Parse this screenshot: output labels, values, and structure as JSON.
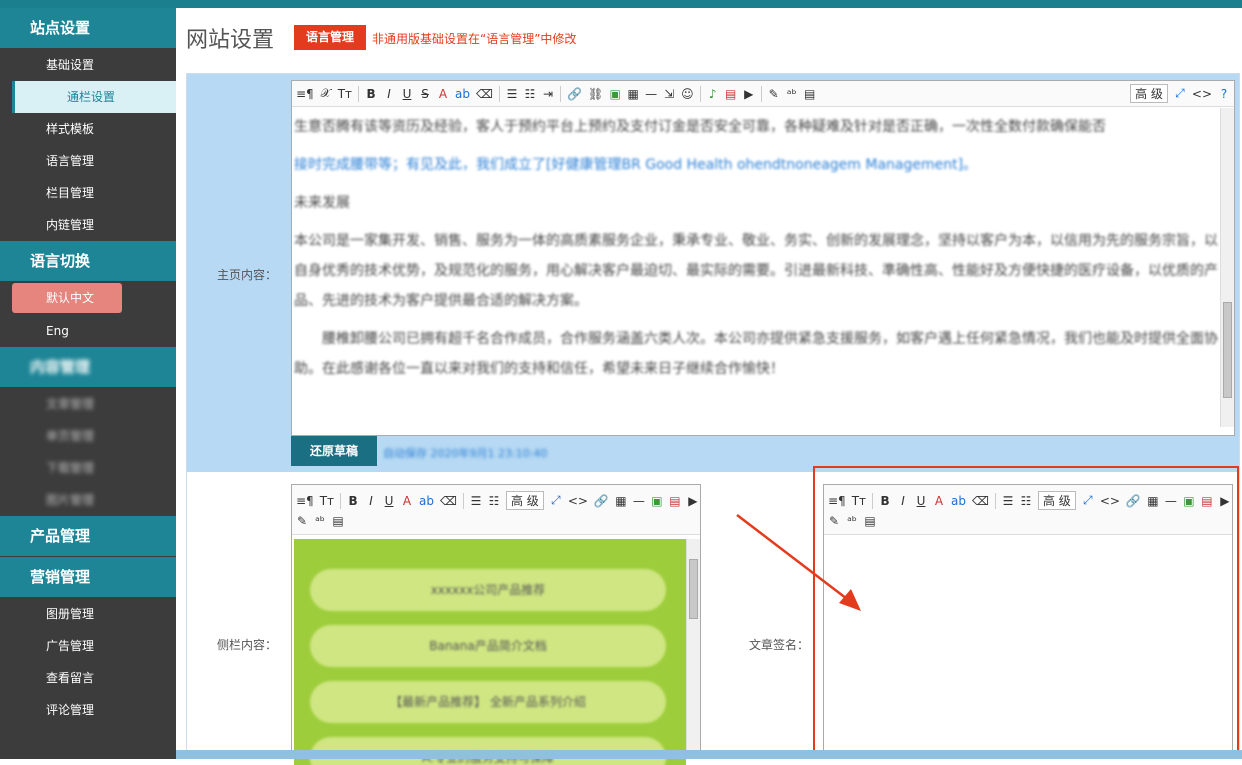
{
  "sidebar": {
    "sections": [
      {
        "title": "站点设置",
        "items": [
          "基础设置",
          "通栏设置",
          "样式模板",
          "语言管理",
          "栏目管理",
          "内链管理"
        ]
      },
      {
        "title": "语言切换",
        "items": [
          "默认中文",
          "Eng"
        ]
      },
      {
        "title": "内容管理",
        "items": [
          "文章管理",
          "单页管理",
          "下载管理",
          "图片管理"
        ]
      },
      {
        "title": "产品管理",
        "items": []
      },
      {
        "title": "营销管理",
        "items": [
          "图册管理",
          "广告管理",
          "查看留言",
          "评论管理"
        ]
      }
    ],
    "active_item": "通栏设置",
    "active_lang": "默认中文"
  },
  "header": {
    "title": "网站设置",
    "lang_button": "语言管理",
    "note": "非通用版基础设置在“语言管理”中修改"
  },
  "form": {
    "home_label": "主页内容：",
    "side_label": "侧栏内容：",
    "sign_label": "文章签名：",
    "restore_button": "还原草稿",
    "restore_meta": "自动保存 2020年9月1 23:10:40",
    "toolbar_level": "高 级",
    "home_paragraphs": [
      "生意否腾有该等资历及经验，客人于预约平台上预约及支付订金是否安全可靠，各种疑难及针对是否正确，一次性全数付款确保能否",
      "接时完成腰带等；有见及此，我们成立了[好健康管理BR Good Health ohendtnoneagem Management]。",
      "未来发展",
      "本公司是一家集开发、销售、服务为一体的高质素服务企业，秉承专业、敬业、务实、创新的发展理念，坚持以客户为本，以信用为先的服务宗旨，以自身优秀的技术优势，及规范化的服务，用心解决客户最迫切、最实际的需要。引进最新科技、準确性高、性能好及方便快捷的医疗设备，以优质的产品、先进的技术为客户提供最合适的解决方案。",
      "腰椎卸腰公司已拥有超千名合作成员，合作服务涵盖六类人次。本公司亦提供紧急支援服务，如客户遇上任何紧急情况，我们也能及时提供全面协助。在此感谢各位一直以来对我们的支持和信任，希望未来日子继续合作愉快！"
    ],
    "side_items": [
      "xxxxxx公司产品推荐",
      "Banana产品简介文档",
      "【最新产品推荐】 全新产品系列介绍",
      "A.专业的服务支持与保障"
    ]
  },
  "colors": {
    "accent": "#1d8596",
    "danger": "#e33b1e",
    "topbar": "#1b7f8e"
  }
}
